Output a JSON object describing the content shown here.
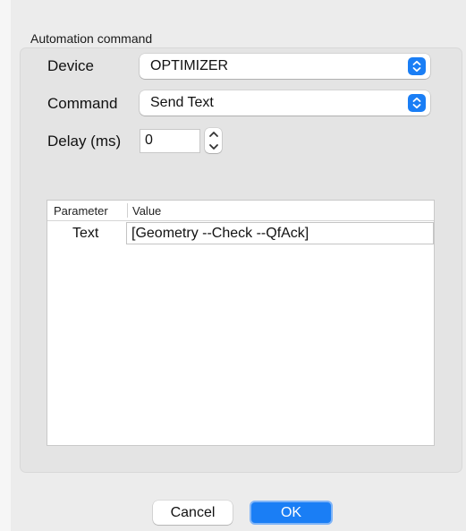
{
  "group": {
    "title": "Automation command"
  },
  "device": {
    "label": "Device",
    "selected": "OPTIMIZER"
  },
  "command": {
    "label": "Command",
    "selected": "Send Text"
  },
  "delay": {
    "label": "Delay (ms)",
    "value": "0"
  },
  "table": {
    "columns": [
      "Parameter",
      "Value"
    ],
    "rows": [
      {
        "parameter": "Text",
        "value": "[Geometry --Check --QfAck]"
      }
    ]
  },
  "buttons": {
    "cancel": "Cancel",
    "ok": "OK"
  },
  "colors": {
    "accent": "#1a7ef5",
    "background": "#ececec"
  },
  "icons": {
    "popup_arrows": "up-down-chevron-icon",
    "stepper_up": "chevron-up-icon",
    "stepper_down": "chevron-down-icon"
  }
}
